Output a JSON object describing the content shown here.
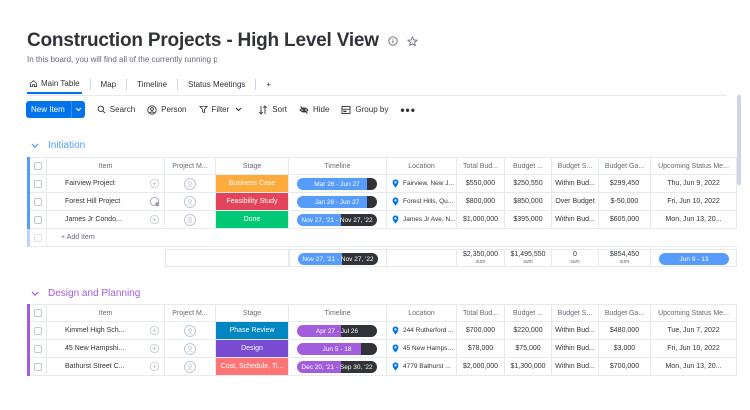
{
  "board": {
    "title": "Construction Projects - High Level View",
    "description": "In this board, you will find all of the currently running p"
  },
  "tabs": [
    {
      "label": "Main Table",
      "active": true
    },
    {
      "label": "Map"
    },
    {
      "label": "Timeline"
    },
    {
      "label": "Status Meetings"
    },
    {
      "label": "+"
    }
  ],
  "toolbar": {
    "new_item": "New Item",
    "search": "Search",
    "person": "Person",
    "filter": "Filter",
    "sort": "Sort",
    "hide": "Hide",
    "group_by": "Group by",
    "more": "•••"
  },
  "columns": [
    "Item",
    "Project M...",
    "Stage",
    "Timeline",
    "Location",
    "Total Bud...",
    "Budget ...",
    "Budget S...",
    "Budget Ga...",
    "Upcoming Status Me..."
  ],
  "groups": [
    {
      "name": "Initiation",
      "color": "#579bfc",
      "rows": [
        {
          "item": "Fairview Project",
          "stage": "Business Case",
          "stage_color": "#fdab3d",
          "timeline": "Mar 26 - Jun 27",
          "location": "Fairview, New J...",
          "total": "$550,000",
          "budget": "$250,550",
          "status": "Within Bud...",
          "gap": "$299,450",
          "meeting": "Thu, Jun 9, 2022"
        },
        {
          "item": "Forest Hill Project",
          "stage": "Feasibility Study",
          "stage_color": "#e2445c",
          "timeline": "Jan 26 - Jun 27",
          "location": "Forest Hills, Qu...",
          "total": "$800,000",
          "budget": "$850,000",
          "status": "Over Budget",
          "gap": "$-50,000",
          "meeting": "Fri, Jun 10, 2022"
        },
        {
          "item": "James Jr Condo...",
          "stage": "Done",
          "stage_color": "#00c875",
          "timeline": "Nov 27, '21 - Nov 27, '22",
          "location": "James Jr Ave, N...",
          "total": "$1,000,000",
          "budget": "$395,000",
          "status": "Within Bud...",
          "gap": "$605,000",
          "meeting": "Mon, Jun 13, 20..."
        }
      ],
      "add_item": "+ Add Item",
      "summary": {
        "timeline": "Nov 27, '21 - Nov 27, '22",
        "total": "$2,350,000",
        "budget": "$1,495,550",
        "status": "0",
        "gap": "$854,450",
        "sum_label": "sum",
        "meeting": "Jun 9 - 13"
      }
    },
    {
      "name": "Design and Planning",
      "color": "#a25ddc",
      "rows": [
        {
          "item": "Kimmel High Sch...",
          "stage": "Phase Review",
          "stage_color": "#0086c0",
          "timeline": "Apr 27 - Jul 26",
          "location": "244 Rutherford ...",
          "total": "$700,000",
          "budget": "$220,000",
          "status": "Within Bud...",
          "gap": "$480,000",
          "meeting": "Tue, Jun 7, 2022"
        },
        {
          "item": "45 New Hampshi...",
          "stage": "Design",
          "stage_color": "#784bd1",
          "timeline": "Jun 5 - 18",
          "location": "45 New Hampsh...",
          "total": "$78,000",
          "budget": "$75,000",
          "status": "Within Bud...",
          "gap": "$3,000",
          "meeting": "Fri, Jun 10, 2022"
        },
        {
          "item": "Bathurst Street C...",
          "stage": "Cost, Schedule, Ti...",
          "stage_color": "#ff7575",
          "timeline": "Dec 20, '21 - Sep 30, '22",
          "location": "4779 Bathurst ...",
          "total": "$2,000,000",
          "budget": "$1,300,000",
          "status": "Within Bud...",
          "gap": "$700,000",
          "meeting": "Mon, Jun 13, 20..."
        }
      ]
    }
  ],
  "colors": {
    "primary": "#0073ea",
    "timeline_blue": "#579bfc",
    "timeline_purple": "#a25ddc",
    "dark": "#323338"
  }
}
